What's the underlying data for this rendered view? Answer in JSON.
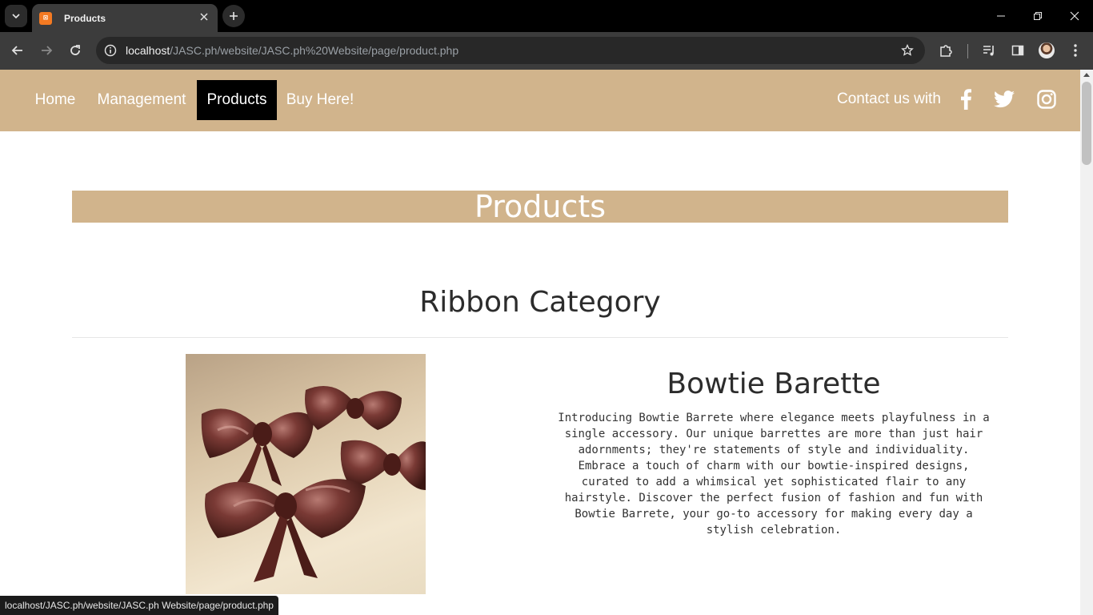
{
  "browser": {
    "tab_title": "Products",
    "url_host": "localhost",
    "url_path": "/JASC.ph/website/JASC.ph%20Website/page/product.php",
    "status_url": "localhost/JASC.ph/website/JASC.ph Website/page/product.php"
  },
  "nav": {
    "links": [
      "Home",
      "Management",
      "Products",
      "Buy Here!"
    ],
    "active": "Products",
    "contact_label": "Contact us with",
    "social_icons": [
      "facebook-icon",
      "twitter-icon",
      "instagram-icon"
    ]
  },
  "page": {
    "banner_title": "Products",
    "category_title": "Ribbon Category"
  },
  "product": {
    "name": "Bowtie Barette",
    "description": "Introducing Bowtie Barrete where elegance meets playfulness in a single accessory. Our unique barrettes are more than just hair adornments; they're statements of style and individuality. Embrace a touch of charm with our bowtie-inspired designs, curated to add a whimsical yet sophisticated flair to any hairstyle. Discover the perfect fusion of fashion and fun with Bowtie Barrete, your go-to accessory for making every day a stylish celebration."
  },
  "colors": {
    "nav_bg": "#d1b48c",
    "active_link_bg": "#000000",
    "banner_bg": "#d1b48c"
  }
}
